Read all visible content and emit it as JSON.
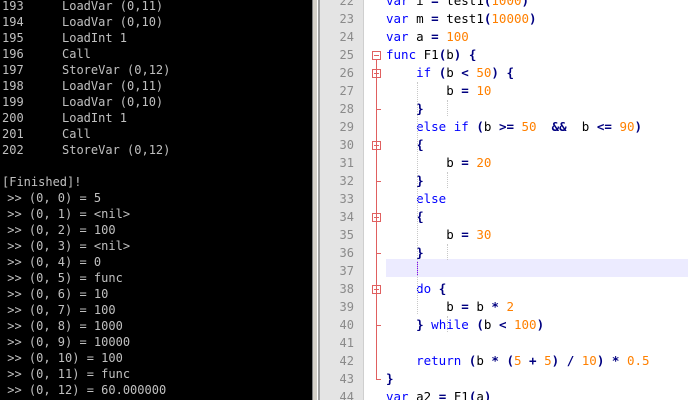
{
  "console": {
    "bytecode": [
      {
        "num": "193",
        "op": "LoadVar (0,11)"
      },
      {
        "num": "194",
        "op": "LoadVar (0,10)"
      },
      {
        "num": "195",
        "op": "LoadInt 1"
      },
      {
        "num": "196",
        "op": "Call"
      },
      {
        "num": "197",
        "op": "StoreVar (0,12)"
      },
      {
        "num": "198",
        "op": "LoadVar (0,11)"
      },
      {
        "num": "199",
        "op": "LoadVar (0,10)"
      },
      {
        "num": "200",
        "op": "LoadInt 1"
      },
      {
        "num": "201",
        "op": "Call"
      },
      {
        "num": "202",
        "op": "StoreVar (0,12)"
      }
    ],
    "finished": "[Finished]!",
    "results": [
      " >> (0, 0) = 5",
      " >> (0, 1) = <nil>",
      " >> (0, 2) = 100",
      " >> (0, 3) = <nil>",
      " >> (0, 4) = 0",
      " >> (0, 5) = func",
      " >> (0, 6) = 10",
      " >> (0, 7) = 100",
      " >> (0, 8) = 1000",
      " >> (0, 9) = 10000",
      " >> (0, 10) = 100",
      " >> (0, 11) = func",
      " >> (0, 12) = 60.000000"
    ]
  },
  "editor": {
    "line_numbers": [
      "22",
      "23",
      "24",
      "25",
      "26",
      "27",
      "28",
      "29",
      "30",
      "31",
      "32",
      "33",
      "34",
      "35",
      "36",
      "37",
      "38",
      "39",
      "40",
      "41",
      "42",
      "43",
      "44"
    ],
    "code": [
      {
        "n": "22",
        "t": "var i = test1(1000)"
      },
      {
        "n": "23",
        "t": "var m = test1(10000)"
      },
      {
        "n": "24",
        "t": "var a = 100"
      },
      {
        "n": "25",
        "t": "func F1(b) {"
      },
      {
        "n": "26",
        "t": "    if (b < 50) {"
      },
      {
        "n": "27",
        "t": "        b = 10"
      },
      {
        "n": "28",
        "t": "    }"
      },
      {
        "n": "29",
        "t": "    else if (b >= 50  &&  b <= 90)"
      },
      {
        "n": "30",
        "t": "    {"
      },
      {
        "n": "31",
        "t": "        b = 20"
      },
      {
        "n": "32",
        "t": "    }"
      },
      {
        "n": "33",
        "t": "    else"
      },
      {
        "n": "34",
        "t": "    {"
      },
      {
        "n": "35",
        "t": "        b = 30"
      },
      {
        "n": "36",
        "t": "    }"
      },
      {
        "n": "37",
        "t": ""
      },
      {
        "n": "38",
        "t": "    do {"
      },
      {
        "n": "39",
        "t": "        b = b * 2"
      },
      {
        "n": "40",
        "t": "    } while (b < 100)"
      },
      {
        "n": "41",
        "t": ""
      },
      {
        "n": "42",
        "t": "    return (b * (5 + 5) / 10) * 0.5"
      },
      {
        "n": "43",
        "t": "}"
      },
      {
        "n": "44",
        "t": "var a2 = F1(a)"
      }
    ]
  },
  "colors": {
    "keyword": "#0000ff",
    "number": "#ff8000",
    "operator": "#000080",
    "fold_marker": "#e06060",
    "current_line": "#ecebff",
    "caret": "#8000ff"
  }
}
